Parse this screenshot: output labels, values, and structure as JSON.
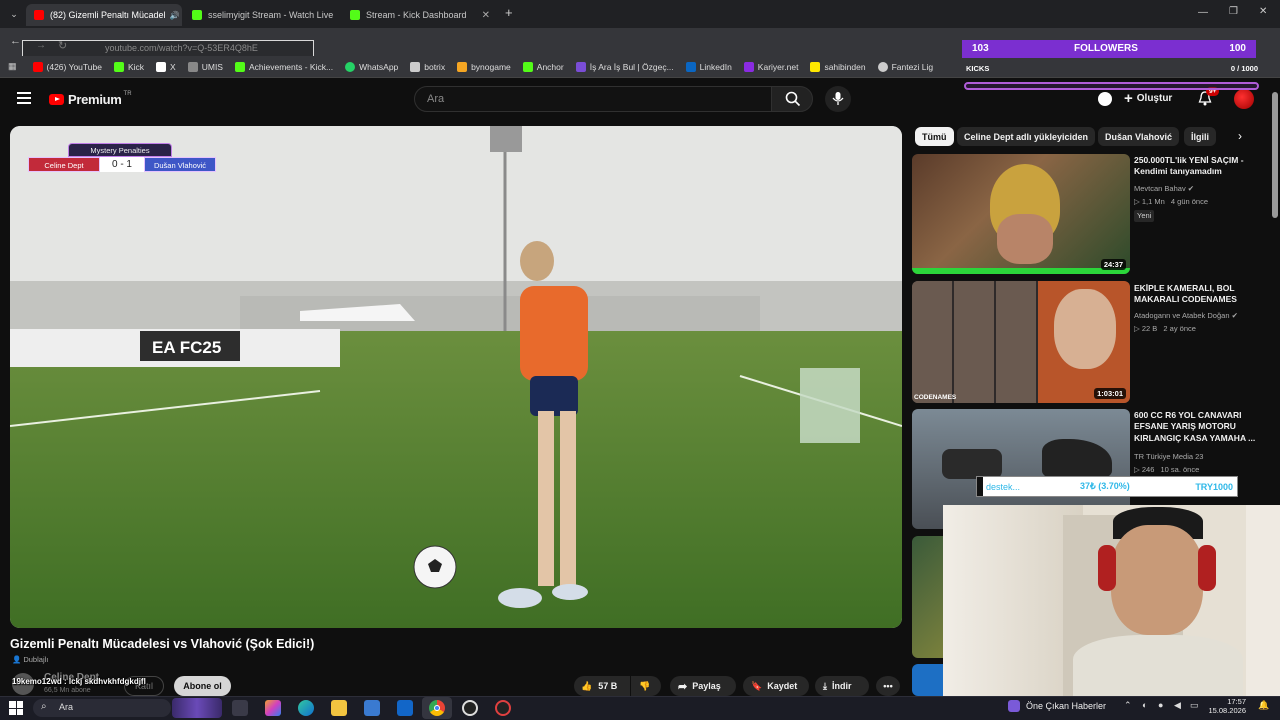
{
  "browser": {
    "tabs": [
      {
        "label": "(82) Gizemli Penaltı Mücadel",
        "active": true
      },
      {
        "label": "sselimyigit Stream - Watch Live",
        "active": false
      },
      {
        "label": "Stream - Kick Dashboard",
        "active": false
      }
    ],
    "new_tab": "+",
    "url": "youtube.com/watch?v=Q-53ER4Q8hE",
    "bookmarks": [
      {
        "label": "(426) YouTube",
        "color": "#ff0000"
      },
      {
        "label": "Kick",
        "color": "#53fc18"
      },
      {
        "label": "X",
        "color": "#ffffff"
      },
      {
        "label": "UMIS",
        "color": "#888888"
      },
      {
        "label": "Achievements - Kick...",
        "color": "#53fc18"
      },
      {
        "label": "WhatsApp",
        "color": "#25d366"
      },
      {
        "label": "botrix",
        "color": "#cccccc"
      },
      {
        "label": "bynogame",
        "color": "#f5a623"
      },
      {
        "label": "Anchor",
        "color": "#53fc18"
      },
      {
        "label": "İş Ara İş Bul | Özgeç...",
        "color": "#7a4dd6"
      },
      {
        "label": "LinkedIn",
        "color": "#0a66c2"
      },
      {
        "label": "Kariyer.net",
        "color": "#8a2be2"
      },
      {
        "label": "sahibinden",
        "color": "#ffe800"
      },
      {
        "label": "Fantezi Lig",
        "color": "#cccccc"
      }
    ]
  },
  "youtube": {
    "logo": "Premium",
    "logo_sup": "TR",
    "search_placeholder": "Ara",
    "create_label": "Oluştur",
    "notif_badge": "9+"
  },
  "video": {
    "title": "Gizemli Penaltı Mücadelesi vs Vlahović (Şok Edici!)",
    "dub_label": "Dublajlı",
    "channel": "Celine Dept",
    "subscribers": "66,5 Mn abone",
    "join_label": "Katıl",
    "subscribe_label": "Abone ol",
    "scoreboard": {
      "header": "Mystery Penalties",
      "left_team": "Celine Dept",
      "score": "0 - 1",
      "right_team": "Dušan Vlahović"
    },
    "sign_text": "EA FC25"
  },
  "actions": {
    "likes": "57 B",
    "share": "Paylaş",
    "save": "Kaydet",
    "download": "İndir"
  },
  "chips": [
    "Tümü",
    "Celine Dept adlı yükleyiciden",
    "Dušan Vlahović",
    "İlgili"
  ],
  "recommendations": [
    {
      "title": "250.000TL'lik YENİ SAÇIM - Kendimi tanıyamadım",
      "channel": "Mevtcan Bahav",
      "views": "1,1 Mn",
      "age": "4 gün önce",
      "badge": "Yeni",
      "duration": "24:37"
    },
    {
      "title": "EKİPLE KAMERALI, BOL MAKARALI CODENAMES",
      "channel": "Atadogann ve Atabek Doğan",
      "views": "22 B",
      "age": "2 ay önce",
      "duration": "1:03:01",
      "thumb_label": "CODENAMES"
    },
    {
      "title": "600 CC R6 YOL CANAVARI EFSANE YARIŞ MOTORU KIRLANGIÇ KASA YAMAHA ...",
      "channel": "TR Türkiye Media 23",
      "views": "246",
      "age": "10 sa. önce"
    }
  ],
  "stream_overlay": {
    "followers_current": "103",
    "followers_label": "FOLLOWERS",
    "followers_goal": "100",
    "kicks_label": "KICKS",
    "kicks_value": "0 / 1000",
    "donation_label": "destek...",
    "donation_amount": "37₺ (3.70%)",
    "donation_goal": "TRY1000",
    "chat_message": "19kemo12wd : lckj skdhvkhfdgkdjfl"
  },
  "taskbar": {
    "search": "Ara",
    "news": "Öne Çıkan Haberler",
    "time": "17:57",
    "date": "15.08.2026"
  }
}
